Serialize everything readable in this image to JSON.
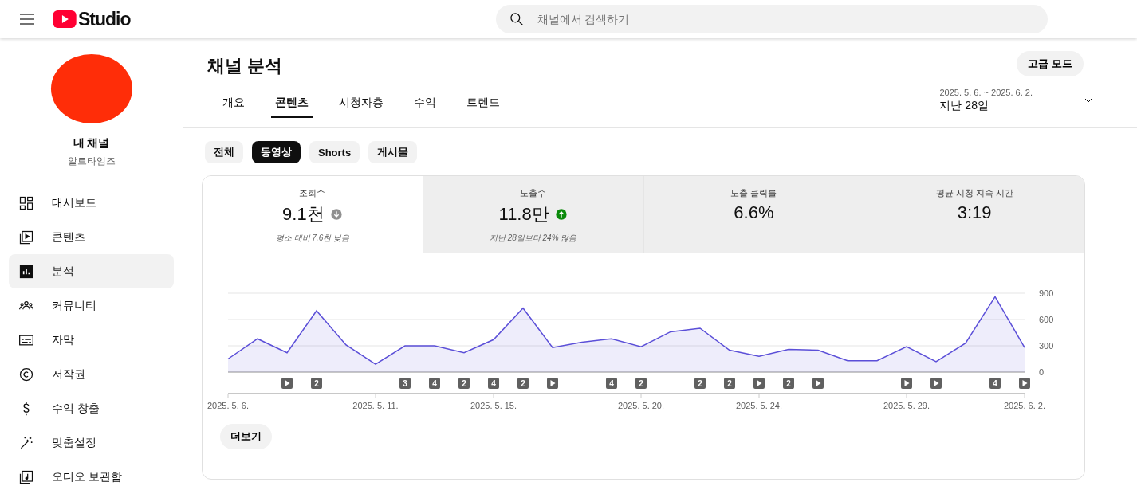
{
  "header": {
    "logo_text": "Studio",
    "search": {
      "placeholder": "채널에서 검색하기"
    }
  },
  "sidebar": {
    "channel_label": "내 채널",
    "channel_name": "알트타임즈",
    "items": [
      {
        "label": "대시보드",
        "selected": false
      },
      {
        "label": "콘텐츠",
        "selected": false
      },
      {
        "label": "분석",
        "selected": true
      },
      {
        "label": "커뮤니티",
        "selected": false
      },
      {
        "label": "자막",
        "selected": false
      },
      {
        "label": "저작권",
        "selected": false
      },
      {
        "label": "수익 창출",
        "selected": false
      },
      {
        "label": "맞춤설정",
        "selected": false
      },
      {
        "label": "오디오 보관함",
        "selected": false
      }
    ]
  },
  "page": {
    "title": "채널 분석",
    "advanced_button": "고급 모드",
    "tabs": [
      {
        "label": "개요",
        "selected": false
      },
      {
        "label": "콘텐츠",
        "selected": true
      },
      {
        "label": "시청자층",
        "selected": false
      },
      {
        "label": "수익",
        "selected": false
      },
      {
        "label": "트렌드",
        "selected": false
      }
    ],
    "date_range": {
      "range": "2025. 5. 6. ~ 2025. 6. 2.",
      "label": "지난 28일"
    },
    "chips": [
      {
        "label": "전체",
        "selected": false
      },
      {
        "label": "동영상",
        "selected": true
      },
      {
        "label": "Shorts",
        "selected": false
      },
      {
        "label": "게시물",
        "selected": false
      }
    ],
    "metrics": [
      {
        "title": "조회수",
        "value": "9.1천",
        "kind": "down",
        "note": "평소 대비 7.6천 낮음",
        "selected": true
      },
      {
        "title": "노출수",
        "value": "11.8만",
        "kind": "up",
        "note": "지난 28일보다 24% 많음",
        "selected": false
      },
      {
        "title": "노출 클릭률",
        "value": "6.6%",
        "kind": "plain",
        "selected": false
      },
      {
        "title": "평균 시청 지속 시간",
        "value": "3:19",
        "kind": "plain",
        "selected": false
      }
    ],
    "chart_data": {
      "type": "area",
      "categories": [
        "2025. 5. 6.",
        null,
        null,
        null,
        null,
        "2025. 5. 11.",
        null,
        null,
        null,
        "2025. 5. 15.",
        null,
        null,
        null,
        null,
        "2025. 5. 20.",
        null,
        null,
        null,
        "2025. 5. 24.",
        null,
        null,
        null,
        null,
        "2025. 5. 29.",
        null,
        null,
        null,
        "2025. 6. 2."
      ],
      "series": [
        {
          "color": "#5b4fd8",
          "values": [
            150,
            380,
            220,
            700,
            310,
            90,
            300,
            300,
            220,
            370,
            730,
            280,
            340,
            380,
            290,
            460,
            500,
            250,
            180,
            260,
            250,
            130,
            130,
            290,
            120,
            330,
            860,
            280
          ]
        }
      ],
      "ylim": [
        0,
        900
      ],
      "yticks": [
        0,
        300,
        600,
        900
      ]
    },
    "markers": [
      {
        "kind": "none"
      },
      {
        "kind": "none"
      },
      {
        "kind": "video"
      },
      {
        "kind": "count",
        "label": "2"
      },
      {
        "kind": "none"
      },
      {
        "kind": "none"
      },
      {
        "kind": "count",
        "label": "3"
      },
      {
        "kind": "count",
        "label": "4"
      },
      {
        "kind": "count",
        "label": "2"
      },
      {
        "kind": "count",
        "label": "4"
      },
      {
        "kind": "count",
        "label": "2"
      },
      {
        "kind": "video"
      },
      {
        "kind": "none"
      },
      {
        "kind": "count",
        "label": "4"
      },
      {
        "kind": "count",
        "label": "2"
      },
      {
        "kind": "none"
      },
      {
        "kind": "count",
        "label": "2"
      },
      {
        "kind": "count",
        "label": "2"
      },
      {
        "kind": "video"
      },
      {
        "kind": "count",
        "label": "2"
      },
      {
        "kind": "video"
      },
      {
        "kind": "none"
      },
      {
        "kind": "none"
      },
      {
        "kind": "video"
      },
      {
        "kind": "video"
      },
      {
        "kind": "none"
      },
      {
        "kind": "count",
        "label": "4"
      },
      {
        "kind": "video"
      }
    ],
    "more_button": "더보기"
  }
}
